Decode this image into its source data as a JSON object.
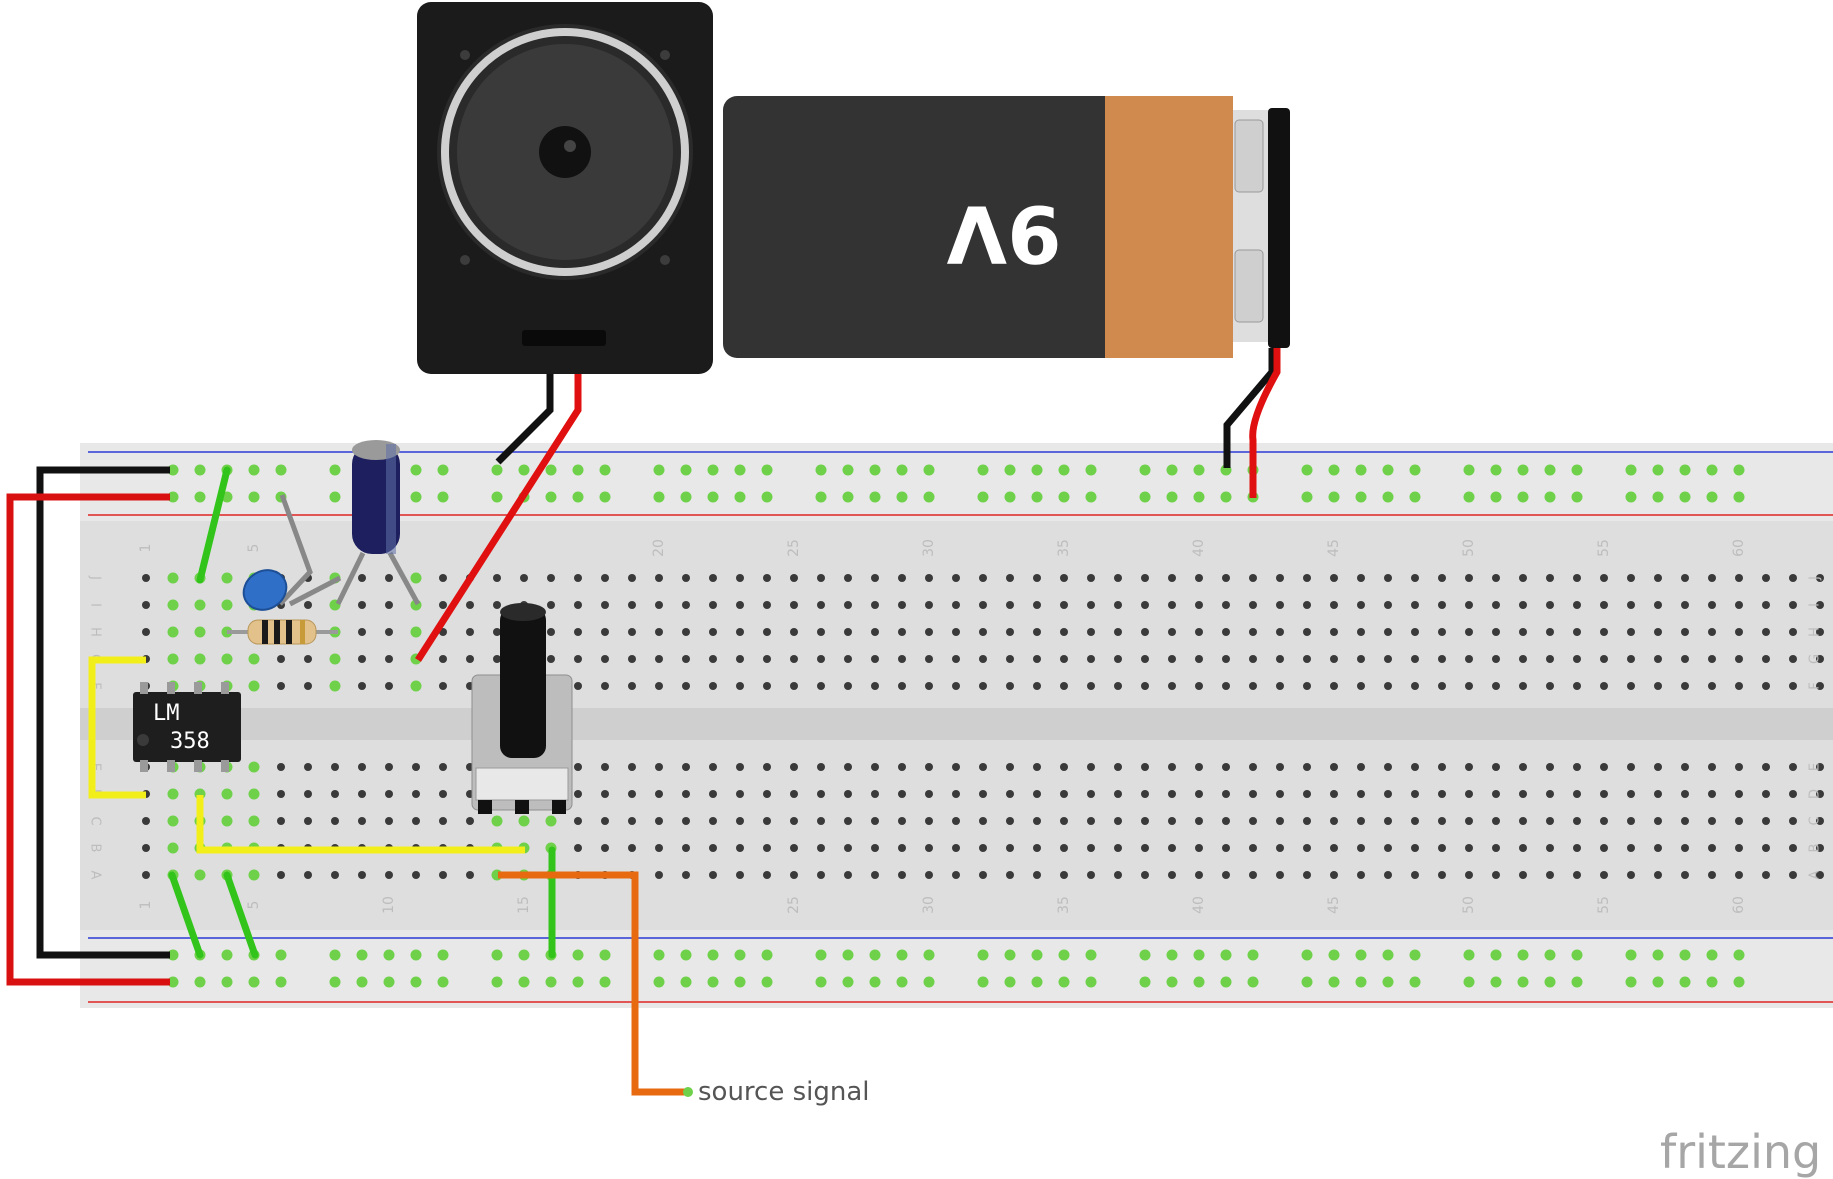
{
  "battery": {
    "label": "9V"
  },
  "ic": {
    "line1": "LM",
    "line2": "358"
  },
  "source_label": "source signal",
  "watermark": "fritzing",
  "breadboard": {
    "row_letters_top": [
      "J",
      "I",
      "H",
      "G",
      "F"
    ],
    "row_letters_bottom": [
      "E",
      "D",
      "C",
      "B",
      "A"
    ],
    "column_numbers_top": [
      "1",
      "5",
      "20",
      "25",
      "30",
      "35",
      "40",
      "45",
      "50",
      "55",
      "60"
    ],
    "column_numbers_bottom": [
      "1",
      "5",
      "10",
      "15",
      "25",
      "30",
      "35",
      "40",
      "45",
      "50",
      "55",
      "60"
    ]
  },
  "colors": {
    "board": "#dcdcdc",
    "hole": "#3a3a3a",
    "connected_hole": "#6fd14a",
    "wire_red": "#e01010",
    "wire_black": "#1a1a1a",
    "wire_green": "#33c41c",
    "wire_yellow": "#f2ee1a",
    "wire_orange": "#e86a10",
    "wire_gray": "#8a8a8a",
    "rail_blue": "#2b3bd6",
    "rail_red": "#e02424"
  }
}
